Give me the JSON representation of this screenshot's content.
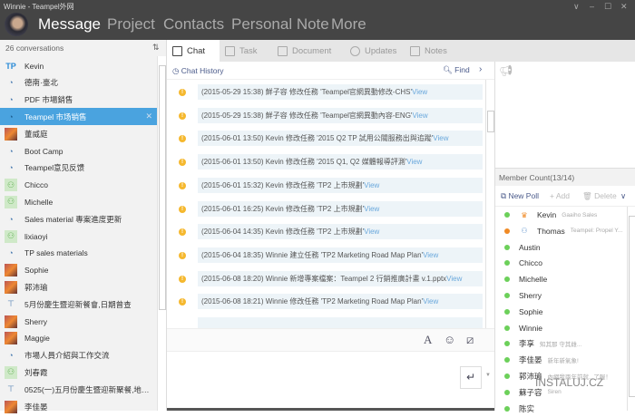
{
  "window": {
    "title": "Winnie - Teampel外网",
    "controls": [
      "∨",
      "–",
      "☐",
      "✕"
    ]
  },
  "nav": [
    "Message",
    "Project",
    "Contacts",
    "Personal Note",
    "More"
  ],
  "sidebar": {
    "count": "26 conversations",
    "sort_icon": "sort-icon",
    "items": [
      {
        "label": "Kevin",
        "icon": "tp"
      },
      {
        "label": "德南·臺北",
        "icon": "chat"
      },
      {
        "label": "PDF 市場銷售",
        "icon": "chat"
      },
      {
        "label": "Teampel 市场销售",
        "icon": "chat",
        "selected": true
      },
      {
        "label": "董威庭",
        "icon": "photo"
      },
      {
        "label": "Boot Camp",
        "icon": "chat"
      },
      {
        "label": "Teampel意见反馈",
        "icon": "chat"
      },
      {
        "label": "Chicco",
        "icon": "user"
      },
      {
        "label": "Michelle",
        "icon": "user"
      },
      {
        "label": "Sales material 專案進度更新",
        "icon": "chat"
      },
      {
        "label": "lixiaoyi",
        "icon": "user"
      },
      {
        "label": "TP sales materials",
        "icon": "chat"
      },
      {
        "label": "Sophie",
        "icon": "photo"
      },
      {
        "label": "郭沛瑜",
        "icon": "photo"
      },
      {
        "label": "5月份慶生暨迎新餐會,日期曾查",
        "icon": "broadcast"
      },
      {
        "label": "Sherry",
        "icon": "photo"
      },
      {
        "label": "Maggie",
        "icon": "photo"
      },
      {
        "label": "市場人員介紹與工作交流",
        "icon": "chat"
      },
      {
        "label": "刘春霞",
        "icon": "user"
      },
      {
        "label": "0525(一)五月份慶生暨迎新聚餐,地點買備...",
        "icon": "broadcast"
      },
      {
        "label": "李佳晏",
        "icon": "photo"
      }
    ]
  },
  "tabs": [
    "Chat",
    "Task",
    "Document",
    "Updates",
    "Notes"
  ],
  "chat": {
    "history": "Chat History",
    "find": "Find",
    "messages": [
      {
        "text": "(2015-05-29 15:38) 鮮子容 修改任務 'Teampel官網異動修改-CHS'",
        "link": "View"
      },
      {
        "text": "(2015-05-29 15:38) 鮮子容 修改任務 'Teampel官網異動內容-ENG'",
        "link": "View"
      },
      {
        "text": "(2015-06-01 13:50) Kevin 修改任務 '2015 Q2 TP 試用公關服務出與追蹤'",
        "link": "View"
      },
      {
        "text": "(2015-06-01 13:50) Kevin 修改任務 '2015 Q1, Q2 媒體報導評測'",
        "link": "View"
      },
      {
        "text": "(2015-06-01 15:32) Kevin 修改任務 'TP2 上市規劃'",
        "link": "View"
      },
      {
        "text": "(2015-06-01 16:25) Kevin 修改任務 'TP2 上市規劃'",
        "link": "View"
      },
      {
        "text": "(2015-06-04 14:35) Kevin 修改任務 'TP2 上市規劃'",
        "link": "View"
      },
      {
        "text": "(2015-06-04 18:35) Winnie 建立任務 'TP2 Marketing Road Map Plan'",
        "link": "View"
      },
      {
        "text": "(2015-06-08 18:20) Winnie 新增專案檔案：Teampel 2 行銷推廣計畫 v.1.pptx",
        "link": "View"
      },
      {
        "text": "(2015-06-08 18:21) Winnie 修改任務 'TP2 Marketing Road Map Plan'",
        "link": "View"
      }
    ]
  },
  "members": {
    "count": "Member Count(13/14)",
    "new_poll": "New Poll",
    "add": "Add",
    "delete": "Delete",
    "list": [
      {
        "name": "Kevin",
        "sig": "Gaaiho Sales",
        "role": "owner"
      },
      {
        "name": "Thomas",
        "sig": "Teampel: Propel Y...",
        "role": "admin",
        "away": true
      },
      {
        "name": "Austin"
      },
      {
        "name": "Chicco"
      },
      {
        "name": "Michelle"
      },
      {
        "name": "Sherry"
      },
      {
        "name": "Sophie"
      },
      {
        "name": "Winnie"
      },
      {
        "name": "李享",
        "sig": "知其那 守其雌..."
      },
      {
        "name": "李佳晏",
        "sig": "新年新氣象!"
      },
      {
        "name": "郭沛瑜",
        "sig": "內網我兩年前就...了喔！"
      },
      {
        "name": "蘇子容",
        "sig": "Siren"
      },
      {
        "name": "陈实"
      }
    ]
  },
  "watermark": "INSTALUJ.CZ"
}
